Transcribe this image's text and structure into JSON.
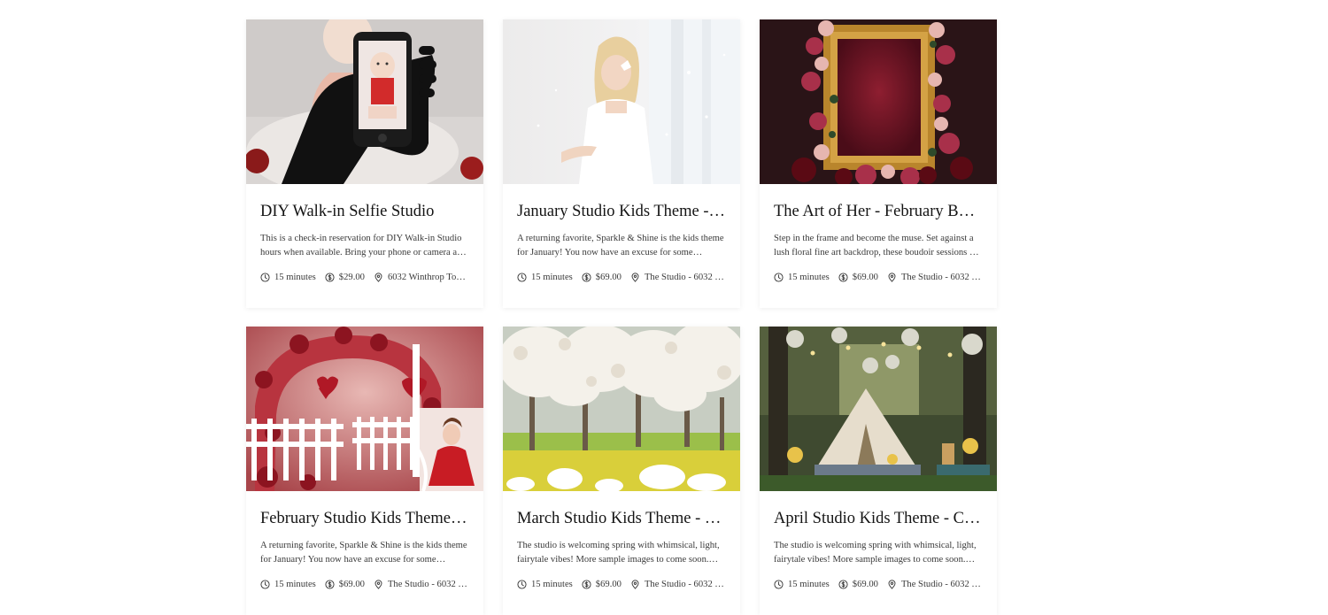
{
  "cards": [
    {
      "title": "DIY Walk-in Selfie Studio",
      "description": "This is a check-in reservation for DIY Walk-in Studio hours when available. Bring your phone or camera and capture...",
      "duration": "15 minutes",
      "price": "$29.00",
      "location": "6032 Winthrop Tow...",
      "image": "phone-selfie-baby-photo"
    },
    {
      "title": "January Studio Kids Theme - Spa...",
      "description": "A returning favorite, Sparkle & Shine is the kids theme for January! You now have an excuse for some absolutely...",
      "duration": "15 minutes",
      "price": "$69.00",
      "location": "The Studio - 6032 W...",
      "image": "girl-white-dress-sparkle"
    },
    {
      "title": "The Art of Her - February Boudoir",
      "description": "Step in the frame and become the muse. Set against a lush floral fine art backdrop, these boudoir sessions are a...",
      "duration": "15 minutes",
      "price": "$69.00",
      "location": "The Studio - 6032 W...",
      "image": "gold-frame-floral-backdrop"
    },
    {
      "title": "February Studio Kids Theme - Va...",
      "description": "A returning favorite, Sparkle & Shine is the kids theme for January! You now have an excuse for some absolutely...",
      "duration": "15 minutes",
      "price": "$69.00",
      "location": "The Studio - 6032 W...",
      "image": "valentine-roses-arch-girl"
    },
    {
      "title": "March Studio Kids Theme - Onc...",
      "description": "The studio is welcoming spring with whimsical, light, fairytale vibes! More sample images to come soon. Sessio...",
      "duration": "15 minutes",
      "price": "$69.00",
      "location": "The Studio - 6032 W...",
      "image": "blossom-trees-spring-meadow"
    },
    {
      "title": "April Studio Kids Theme - Camp...",
      "description": "The studio is welcoming spring with whimsical, light, fairytale vibes! More sample images to come soon. Sessio...",
      "duration": "15 minutes",
      "price": "$69.00",
      "location": "The Studio - 6032 W...",
      "image": "forest-tent-campsite"
    }
  ],
  "icons": {
    "duration": "clock-icon",
    "price": "dollar-circle-icon",
    "location": "map-pin-icon"
  }
}
